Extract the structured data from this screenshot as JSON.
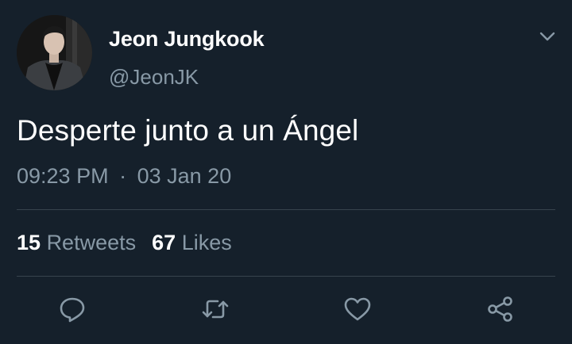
{
  "author": {
    "name": "Jeon Jungkook",
    "handle": "@JeonJK",
    "avatar_icon": "profile-photo"
  },
  "tweet": {
    "text": "Desperte junto a un Ángel",
    "time": "09:23 PM",
    "separator": "·",
    "date": "03 Jan 20"
  },
  "stats": {
    "retweets_count": "15",
    "retweets_label": "Retweets",
    "likes_count": "67",
    "likes_label": "Likes"
  },
  "actions": [
    {
      "icon": "reply-icon"
    },
    {
      "icon": "retweet-icon"
    },
    {
      "icon": "like-icon"
    },
    {
      "icon": "share-icon"
    }
  ],
  "colors": {
    "background": "#15202b",
    "primary_text": "#ffffff",
    "secondary_text": "#8899a6",
    "divider": "#38444d"
  }
}
